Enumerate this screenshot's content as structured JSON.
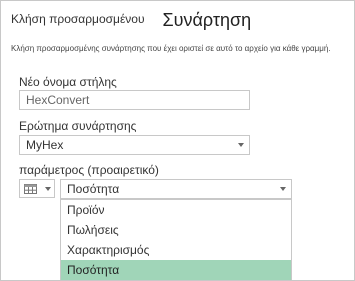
{
  "dialog": {
    "title_small": "Κλήση προσαρμοσμένου",
    "title_large": "Συνάρτηση",
    "description": "Κλήση προσαρμοσμένης συνάρτησης που έχει οριστεί σε αυτό το αρχείο για κάθε γραμμή."
  },
  "column_name": {
    "label": "Νέο όνομα στήλης",
    "value": "HexConvert"
  },
  "function_query": {
    "label": "Ερώτημα συνάρτησης",
    "selected": "MyHex"
  },
  "parameter": {
    "label": "παράμετρος (προαιρετικό)",
    "selected": "Ποσότητα",
    "type_icon": "table-icon"
  },
  "dropdown": {
    "options": [
      "Προϊόν",
      "Πωλήσεις",
      "Χαρακτηρισμός",
      "Ποσότητα"
    ],
    "highlighted": "Ποσότητα",
    "highlight_color": "#a0d5b8"
  }
}
